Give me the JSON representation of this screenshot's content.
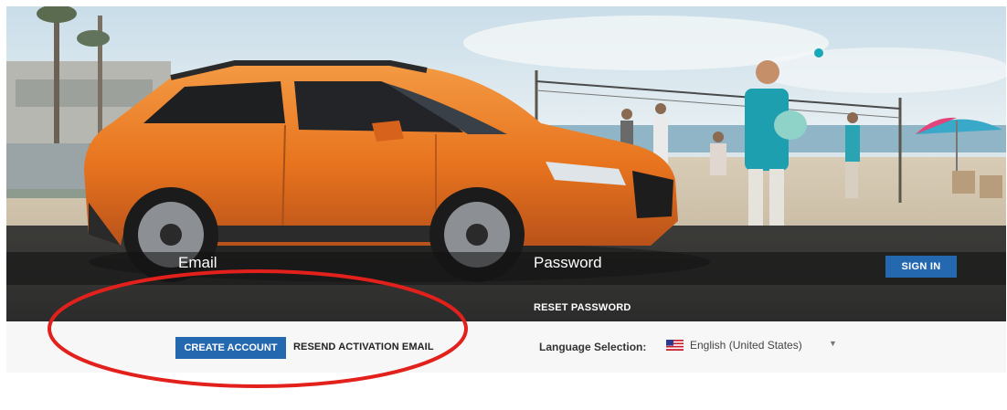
{
  "login": {
    "email_label": "Email",
    "password_label": "Password",
    "signin_label": "SIGN IN",
    "reset_label": "RESET PASSWORD"
  },
  "account": {
    "create_label": "CREATE ACCOUNT",
    "resend_label": "RESEND ACTIVATION EMAIL"
  },
  "language": {
    "label": "Language Selection:",
    "selected": "English (United States)",
    "flag": "us-flag-icon"
  },
  "colors": {
    "button_blue": "#2468b0",
    "car_orange": "#e8741e",
    "annotation_red": "#e2201c"
  },
  "hero": {
    "subject": "hero-image"
  }
}
